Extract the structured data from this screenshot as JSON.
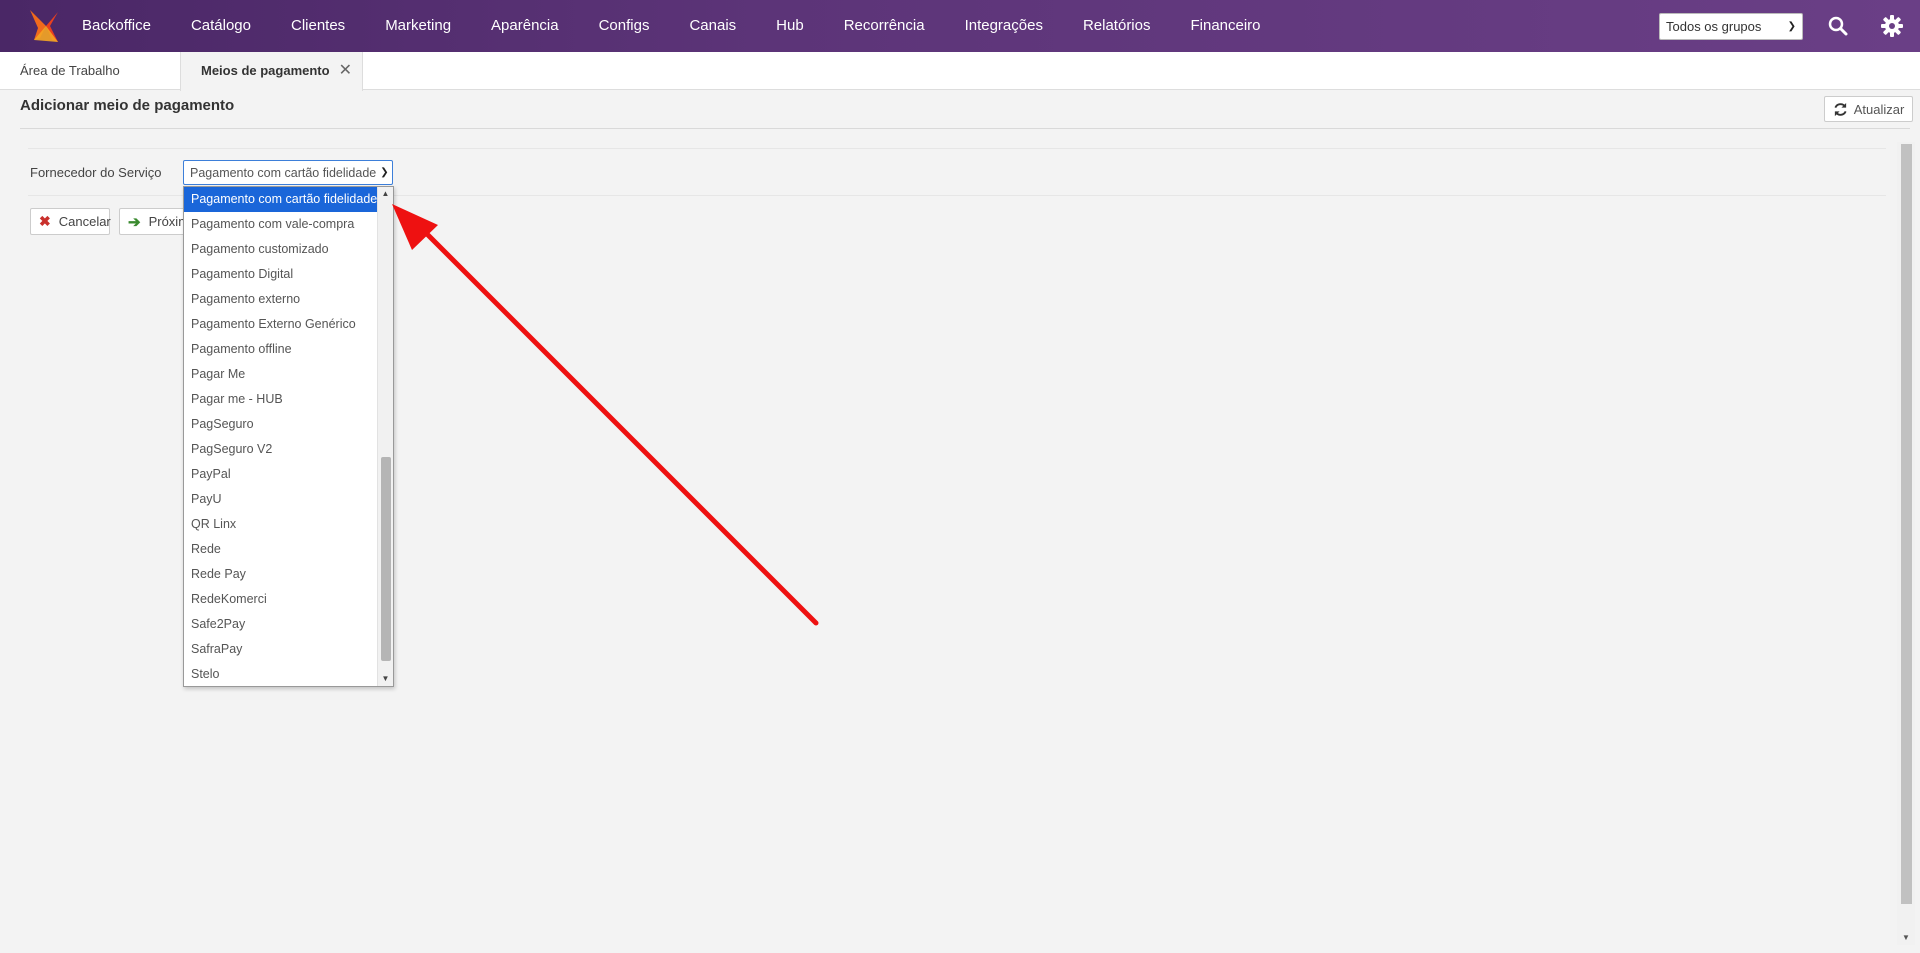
{
  "topbar": {
    "nav": [
      "Backoffice",
      "Catálogo",
      "Clientes",
      "Marketing",
      "Aparência",
      "Configs",
      "Canais",
      "Hub",
      "Recorrência",
      "Integrações",
      "Relatórios",
      "Financeiro"
    ],
    "group_select": "Todos os grupos",
    "accent_color": "#5c3478"
  },
  "tabs": {
    "workspace": "Área de Trabalho",
    "active": "Meios de pagamento",
    "close_glyph": "✕"
  },
  "page": {
    "title": "Adicionar meio de pagamento",
    "refresh_label": "Atualizar"
  },
  "form": {
    "provider_label": "Fornecedor do Serviço",
    "provider_value": "Pagamento com cartão fidelidade",
    "cancel_label": "Cancelar",
    "next_label": "Próxim"
  },
  "dropdown": {
    "selected_index": 0,
    "options": [
      "Pagamento com cartão fidelidade",
      "Pagamento com vale-compra",
      "Pagamento customizado",
      "Pagamento Digital",
      "Pagamento externo",
      "Pagamento Externo Genérico",
      "Pagamento offline",
      "Pagar Me",
      "Pagar me - HUB",
      "PagSeguro",
      "PagSeguro V2",
      "PayPal",
      "PayU",
      "QR Linx",
      "Rede",
      "Rede Pay",
      "RedeKomerci",
      "Safe2Pay",
      "SafraPay",
      "Stelo"
    ]
  },
  "annotation": {
    "color": "#ee1111"
  }
}
